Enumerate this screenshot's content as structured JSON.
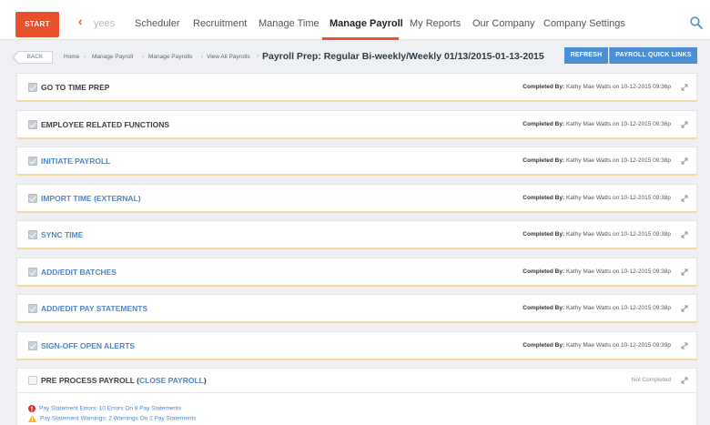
{
  "nav": {
    "start_label": "START",
    "prev_label": "‹",
    "items": [
      {
        "label": "yees",
        "faded": true
      },
      {
        "label": "Scheduler"
      },
      {
        "label": "Recruitment"
      },
      {
        "label": "Manage Time"
      },
      {
        "label": "Manage Payroll",
        "active": true
      },
      {
        "label": "My Reports"
      },
      {
        "label": "Our Company"
      },
      {
        "label": "Company Settings"
      }
    ],
    "accent_color": "#e8522a"
  },
  "breadcrumb": {
    "back_label": "BACK",
    "items": [
      "Home",
      "Manage Payroll",
      "Manage Payrolls",
      "View All Payrolls"
    ],
    "current": "Payroll Prep: Regular Bi-weekly/Weekly 01/13/2015-01-13-2015"
  },
  "actions": {
    "refresh_label": "REFRESH",
    "quick_links_label": "PAYROLL QUICK LINKS",
    "button_color": "#4d8ed6"
  },
  "steps": [
    {
      "title": "GO TO TIME PREP",
      "style": "dark",
      "status_label": "Completed By:",
      "status_value": "Kathy Mae Watts on 10-12-2015 09:36p"
    },
    {
      "title": "EMPLOYEE RELATED FUNCTIONS",
      "style": "dark",
      "status_label": "Completed By:",
      "status_value": "Kathy Mae Watts on 10-12-2015 09:36p"
    },
    {
      "title": "INITIATE PAYROLL",
      "style": "blue",
      "status_label": "Completed By:",
      "status_value": "Kathy Mae Watts on 10-12-2015 09:38p"
    },
    {
      "title": "IMPORT TIME (EXTERNAL)",
      "style": "blue",
      "status_label": "Completed By:",
      "status_value": "Kathy Mae Watts on 10-12-2015 09:38p"
    },
    {
      "title": "SYNC TIME",
      "style": "blue",
      "status_label": "Completed By:",
      "status_value": "Kathy Mae Watts on 10-12-2015 09:38p"
    },
    {
      "title": "ADD/EDIT BATCHES",
      "style": "blue",
      "status_label": "Completed By:",
      "status_value": "Kathy Mae Watts on 10-12-2015 09:38p"
    },
    {
      "title": "ADD/EDIT PAY STATEMENTS",
      "style": "blue",
      "status_label": "Completed By:",
      "status_value": "Kathy Mae Watts on 10-12-2015 09:38p"
    },
    {
      "title": "SIGN-OFF OPEN ALERTS",
      "style": "blue",
      "status_label": "Completed By:",
      "status_value": "Kathy Mae Watts on 10-12-2015 09:39p"
    }
  ],
  "pre_process": {
    "title": "PRE PROCESS PAYROLL (",
    "link": "CLOSE PAYROLL",
    "title_end": ")",
    "status": "Not Completed"
  },
  "alerts": [
    {
      "icon": "error-icon",
      "text": "Pay Statement Errors: 10 Errors On 8 Pay Statements",
      "color": "#d9342b"
    },
    {
      "icon": "warning-icon",
      "text": "Pay Statement Warnings: 2 Warnings On 2 Pay Statements",
      "color": "#f2b632"
    }
  ]
}
